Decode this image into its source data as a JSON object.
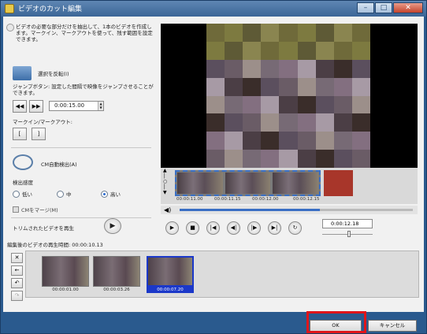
{
  "window": {
    "title": "ビデオのカット編集"
  },
  "left": {
    "description": "ビデオの必要な部分だけを抽出して、1本のビデオを作成します。マークイン、マークアウトを使って、残す範囲を設定できます。",
    "invert_label": "選択を反転(I)",
    "jump_description": "ジャンプボタン: 設定した間隔で映像をジャンプさせることができます。",
    "jump_interval": "0:00:15.00",
    "markio_label": "マークイン/マークアウト:",
    "markin_glyph": "[",
    "markout_glyph": "]",
    "cm_detect_label": "CM自動検出(A)",
    "sensitivity_label": "検出感度",
    "sensitivity_options": [
      "低い",
      "中",
      "高い"
    ],
    "sensitivity_selected": "高い",
    "cm_merge_label": "CMをマージ(M)",
    "trim_play_label": "トリムされたビデオを再生",
    "edited_playtime": "編集後のビデオの再生時間: 00:00:10.13"
  },
  "timeline": {
    "times": [
      "00:00:11.00",
      "00:00:11.15",
      "00:00:12.00",
      "00:00:12.15"
    ]
  },
  "player": {
    "current_time": "0:00:12.18",
    "progress": 0.6,
    "speed": 0.53
  },
  "clips": [
    {
      "time": "00:00:01.00",
      "selected": false
    },
    {
      "time": "00:00:03.26",
      "selected": false
    },
    {
      "time": "00:00:07.20",
      "selected": true
    }
  ],
  "buttons": {
    "ok": "OK",
    "cancel": "キャンセル"
  },
  "icons": {
    "rewind": "rewind-icon",
    "fastforward": "fast-forward-icon",
    "play": "play-icon",
    "stop": "stop-icon"
  },
  "colors": {
    "highlight": "#e0151a",
    "selection": "#1b38c9"
  }
}
